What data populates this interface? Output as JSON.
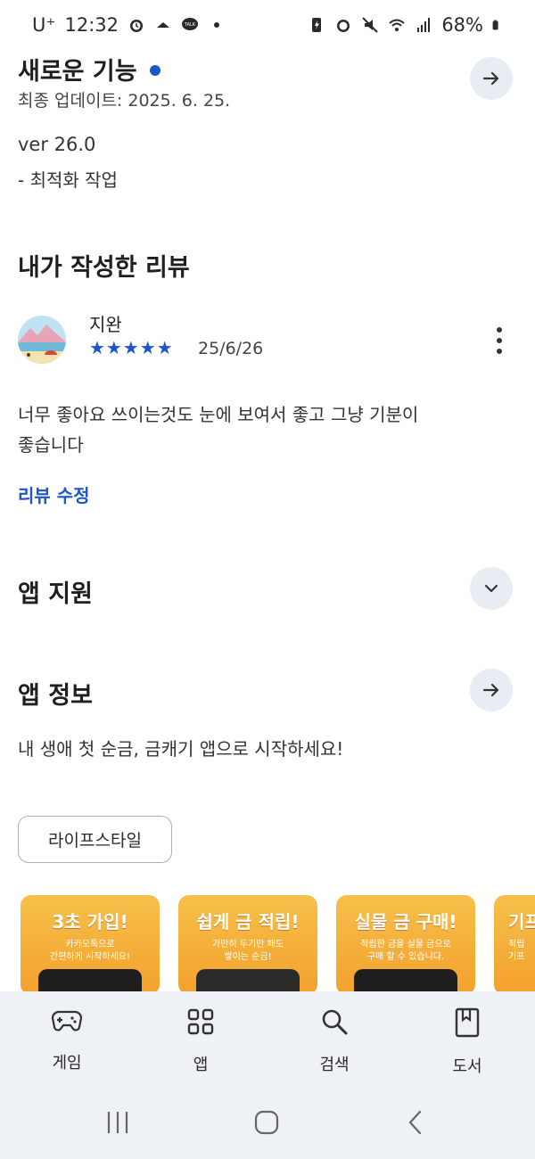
{
  "status_bar": {
    "carrier": "U⁺",
    "time": "12:32",
    "battery": "68%"
  },
  "whats_new": {
    "title": "새로운 기능",
    "updated": "최종 업데이트: 2025. 6. 25.",
    "version": "ver 26.0",
    "note": "- 최적화 작업"
  },
  "my_review": {
    "section_title": "내가 작성한 리뷰",
    "user_name": "지완",
    "stars": "★★★★★",
    "date": "25/6/26",
    "text_line1": "너무 좋아요 쓰이는것도 눈에 보여서 좋고 그냥 기분이",
    "text_line2": "좋습니다",
    "edit_label": "리뷰 수정"
  },
  "app_support": {
    "title": "앱 지원"
  },
  "app_info": {
    "title": "앱 정보",
    "description": "내 생애 첫 순금, 금캐기 앱으로 시작하세요!",
    "category_chip": "라이프스타일"
  },
  "screenshots": [
    {
      "headline": "3초 가입!",
      "sub1": "카카오톡으로",
      "sub2": "간편하게 시작하세요!"
    },
    {
      "headline": "쉽게 금 적립!",
      "sub1": "가만히 두기만 해도",
      "sub2": "쌓이는 순금!"
    },
    {
      "headline": "실물 금 구매!",
      "sub1": "적립한 금을 실물 금으로",
      "sub2": "구매 할 수 있습니다."
    },
    {
      "headline": "기프",
      "sub1": "적립",
      "sub2": "기프"
    }
  ],
  "bottom_nav": {
    "items": [
      {
        "label": "게임",
        "icon": "gamepad-icon"
      },
      {
        "label": "앱",
        "icon": "apps-grid-icon"
      },
      {
        "label": "검색",
        "icon": "search-icon"
      },
      {
        "label": "도서",
        "icon": "book-icon"
      }
    ]
  },
  "colors": {
    "accent": "#1e56c8",
    "button_bg": "#e8edf4",
    "nav_bg": "#eef1f6",
    "screenshot_bg": "#f3a12d"
  }
}
